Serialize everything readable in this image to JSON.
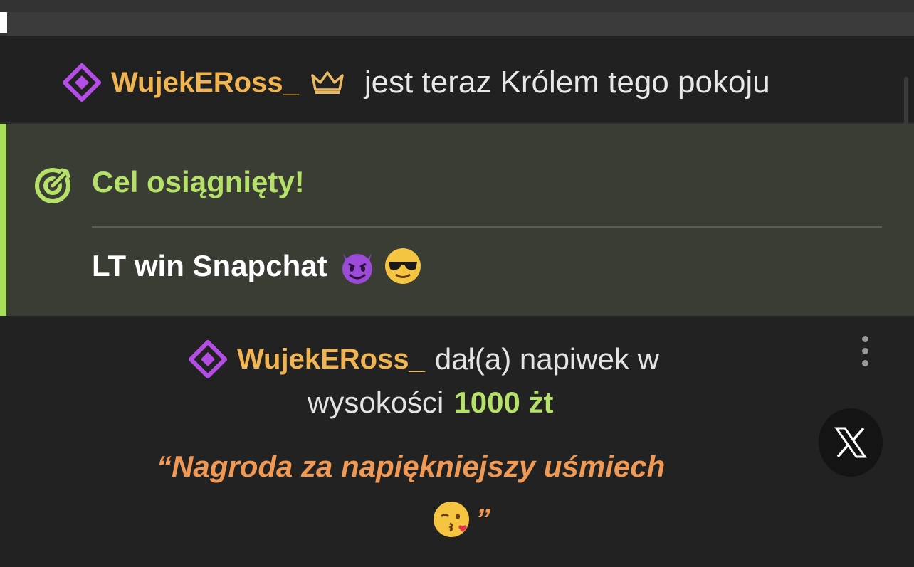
{
  "king": {
    "username": "WujekERoss_",
    "message": "jest teraz Królem tego pokoju"
  },
  "goal": {
    "title": "Cel osiągnięty!",
    "text": "LT win Snapchat",
    "emojis": [
      "smiling-devil",
      "sunglasses-face"
    ]
  },
  "tip": {
    "username": "WujekERoss_",
    "text_before_amount_line1": "dał(a) napiwek w",
    "text_before_amount_line2": "wysokości",
    "amount": "1000 żt",
    "quote_line1": "“Nagroda za napiękniejszy uśmiech",
    "quote_end": "”",
    "quote_emoji": "kissing-face"
  },
  "colors": {
    "username": "#f0b452",
    "goal_green": "#b5e06a",
    "quote_orange": "#ef9955",
    "diamond_purple": "#b44ce6"
  },
  "icons": [
    "diamond-icon",
    "crown-icon",
    "target-icon",
    "kebab-menu-icon",
    "x-logo-icon"
  ]
}
